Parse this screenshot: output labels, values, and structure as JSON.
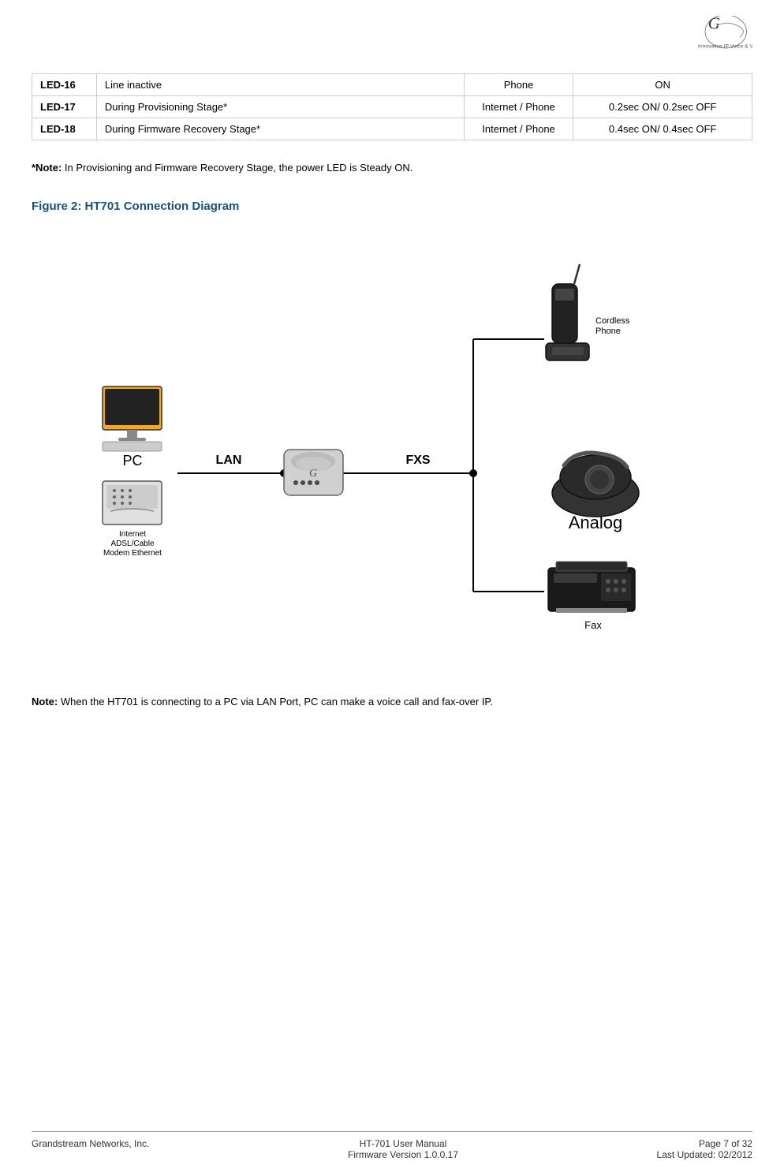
{
  "logo": {
    "alt": "Grandstream Logo"
  },
  "table": {
    "rows": [
      {
        "led": "LED-16",
        "description": "Line inactive",
        "device": "Phone",
        "status": "ON"
      },
      {
        "led": "LED-17",
        "description": "During Provisioning Stage*",
        "device": "Internet / Phone",
        "status": "0.2sec ON/ 0.2sec OFF"
      },
      {
        "led": "LED-18",
        "description": "During Firmware Recovery Stage*",
        "device": "Internet / Phone",
        "status": "0.4sec ON/ 0.4sec OFF"
      }
    ]
  },
  "note": "*Note: In Provisioning and Firmware Recovery Stage, the power LED is Steady ON.",
  "figure_title": "Figure 2:  HT701 Connection Diagram",
  "diagram": {
    "labels": {
      "pc": "PC",
      "lan": "LAN",
      "fxs": "FXS",
      "internet": "Internet\nADSL/Cable\nModem Ethernet",
      "cordless": "Cordless\nPhone",
      "analog": "Analog",
      "fax": "Fax"
    }
  },
  "bottom_note": "Note: When the HT701 is connecting to a PC via LAN Port, PC can make a voice call and fax-over IP.",
  "footer": {
    "left": "Grandstream Networks, Inc.",
    "center_line1": "HT-701 User Manual",
    "center_line2": "Firmware Version 1.0.0.17",
    "right_line1": "Page 7 of 32",
    "right_line2": "Last Updated: 02/2012"
  }
}
